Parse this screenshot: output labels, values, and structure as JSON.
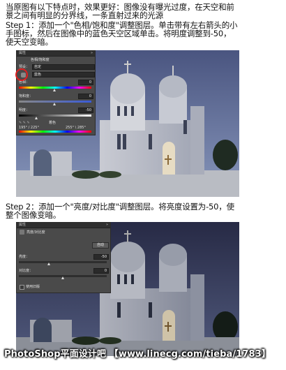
{
  "intro": {
    "line1": "当原图有以下特点时，效果更好：图像没有曝光过度，在天空和前",
    "line2": "景之间有明显的分界线，一条直射过来的光源"
  },
  "step1": {
    "line1": "Step 1：添加一个\"色相/饱和度\"调整图层。单击带有左右箭头的小",
    "line2": "手图标，然后在图像中的蓝色天空区域单击。将明度调整到-50，",
    "line3": "使天空变暗。"
  },
  "step2": {
    "line1": "Step 2：添加一个\"亮度/对比度\"调整图层。将亮度设置为-50，使",
    "line2": "整个图像变暗。"
  },
  "panel1": {
    "tab": "属性",
    "collapse_icon": "double-arrow-icon",
    "heading": "色相/饱和度",
    "preset_label": "预设：",
    "preset_value": "自定",
    "channel_value": "蓝色",
    "hue_label": "色相：",
    "hue_value": "0",
    "sat_label": "饱和度：",
    "sat_value": "0",
    "light_label": "明度：",
    "light_value": "-50",
    "colorize_label": "着色",
    "range_left": "195° / 225°",
    "range_right": "255° \\ 285°"
  },
  "panel2": {
    "tab": "属性",
    "heading": "亮度/对比度",
    "auto_button": "自动",
    "brightness_label": "亮度：",
    "brightness_value": "-50",
    "contrast_label": "对比度：",
    "contrast_value": "0",
    "legacy_label": "使用旧版"
  },
  "colors": {
    "sky1": "#7d8db4",
    "sky2": "#2d2f4e",
    "highlight": "#e02020"
  },
  "watermark": "PhotoShop平面设计吧 【www.linecg.com/tieba/1783】"
}
